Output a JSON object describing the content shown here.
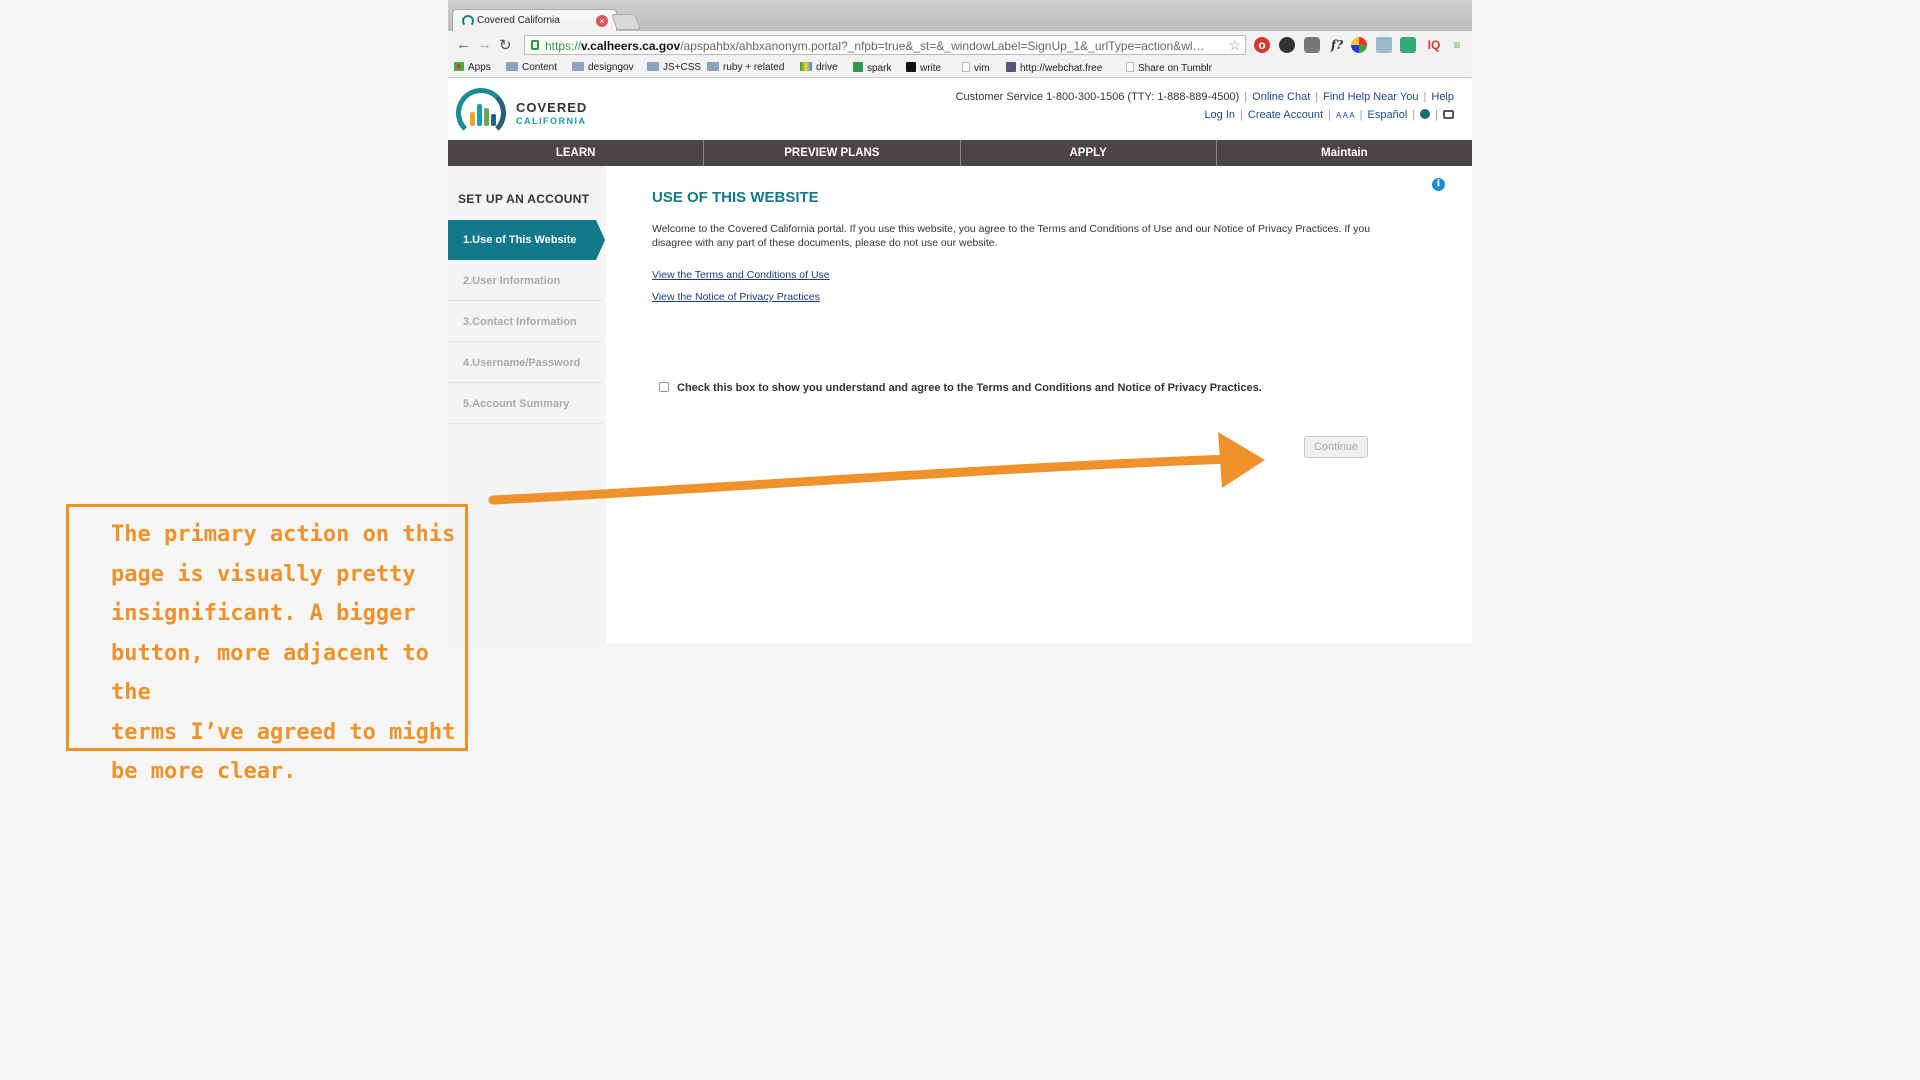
{
  "browser": {
    "tab_title": "Covered California",
    "url_scheme": "https://",
    "url_host": "v.calheers.ca.gov",
    "url_rest": "/apspahbx/ahbxanonym.portal?_nfpb=true&_st=&_windowLabel=SignUp_1&_urlType=action&wl…",
    "extensions": [
      "opera-icon",
      "dark-circle-icon",
      "pocket-icon",
      "f?",
      "chrome-colors-icon",
      "copy-icon",
      "new-badge-icon",
      "IQ",
      "menu-icon"
    ],
    "bookmarks": [
      "Apps",
      "Content",
      "designgov",
      "JS+CSS",
      "ruby + related",
      "drive",
      "spark",
      "write",
      "vim",
      "http://webchat.free",
      "Share on Tumblr"
    ]
  },
  "header": {
    "logo_line1": "COVERED",
    "logo_line2": "CALIFORNIA",
    "customer_service": "Customer Service 1-800-300-1506 (TTY: 1-888-889-4500)",
    "online_chat": "Online Chat",
    "find_help": "Find Help Near You",
    "help": "Help",
    "log_in": "Log In",
    "create_account": "Create Account",
    "text_size": "A A A",
    "espanol": "Español"
  },
  "nav": {
    "items": [
      "LEARN",
      "PREVIEW PLANS",
      "APPLY",
      "Maintain"
    ]
  },
  "sidebar": {
    "title": "SET UP AN ACCOUNT",
    "steps": [
      "1.Use of This Website",
      "2.User Information",
      "3.Contact Information",
      "4.Username/Password",
      "5.Account Summary"
    ],
    "active_step": 1
  },
  "content": {
    "title": "USE OF THIS WEBSITE",
    "welcome": "Welcome to the Covered California portal. If you use this website, you agree to the Terms and Conditions of Use and our Notice of Privacy Practices. If you disagree with any part of these documents, please do not use our website.",
    "terms_link": "View the Terms and Conditions of Use",
    "privacy_link": "View the Notice of Privacy Practices",
    "agree_label": "Check this box to show you understand and agree to the Terms and Conditions and Notice of Privacy Practices.",
    "agree_checked": false,
    "continue_label": "Continue"
  },
  "annotation": {
    "text": "The primary action on this\npage is visually pretty\ninsignificant. A bigger\nbutton, more adjacent to the\nterms I’ve agreed to might\nbe more clear.",
    "color": "#f0922b"
  }
}
